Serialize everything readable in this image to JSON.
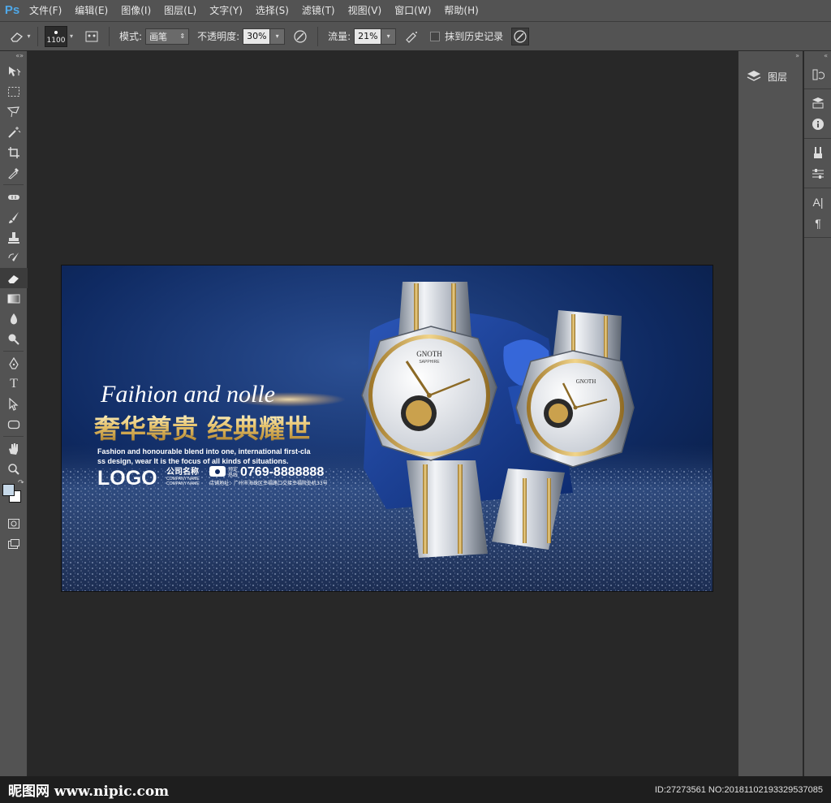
{
  "app": {
    "logo": "Ps"
  },
  "menu": [
    "文件(F)",
    "编辑(E)",
    "图像(I)",
    "图层(L)",
    "文字(Y)",
    "选择(S)",
    "滤镜(T)",
    "视图(V)",
    "窗口(W)",
    "帮助(H)"
  ],
  "options": {
    "brush_size": "1100",
    "mode_label": "模式:",
    "mode_value": "画笔",
    "opacity_label": "不透明度:",
    "opacity_value": "30%",
    "flow_label": "流量:",
    "flow_value": "21%",
    "history_label": "抹到历史记录"
  },
  "tools": [
    "move-tool",
    "marquee-tool",
    "lasso-tool",
    "magic-wand-tool",
    "crop-tool",
    "eyedropper-tool",
    "healing-brush-tool",
    "brush-tool",
    "clone-stamp-tool",
    "history-brush-tool",
    "eraser-tool",
    "gradient-tool",
    "blur-tool",
    "dodge-tool",
    "pen-tool",
    "type-tool",
    "path-selection-tool",
    "shape-tool",
    "hand-tool",
    "zoom-tool"
  ],
  "colors": {
    "foreground": "#c6d8e8",
    "background": "#ffffff",
    "accent": "#4fa8e8",
    "gold": "#d9b35a"
  },
  "panels": {
    "layers_tab": "图层"
  },
  "artwork": {
    "script_title": "Faihion and nolle",
    "headline": "奢华尊贵 经典耀世",
    "subtitle_line1": "Fashion and honourable blend into one, international first-cla",
    "subtitle_line2": "ss design, wear It is the focus of all kinds of situations.",
    "logo": "LOGO",
    "company_name_cn": "公司名称",
    "company_name_en1": "COMPANY NAME",
    "company_name_en2": "COMPANY NAME",
    "phone_label1": "预定",
    "phone_label2": "热线",
    "phone": "0769-8888888",
    "address": "店铺地址：广州市海珠区幸福路口交接幸福院处机33号",
    "watch_brand_large": "GNOTH",
    "watch_sub_large": "SAPPHIRE",
    "watch_brand_small": "GNOTH"
  },
  "footer": {
    "site": "昵图网 www.nipic.com",
    "id": "ID:27273561 NO:20181102193329537085"
  }
}
